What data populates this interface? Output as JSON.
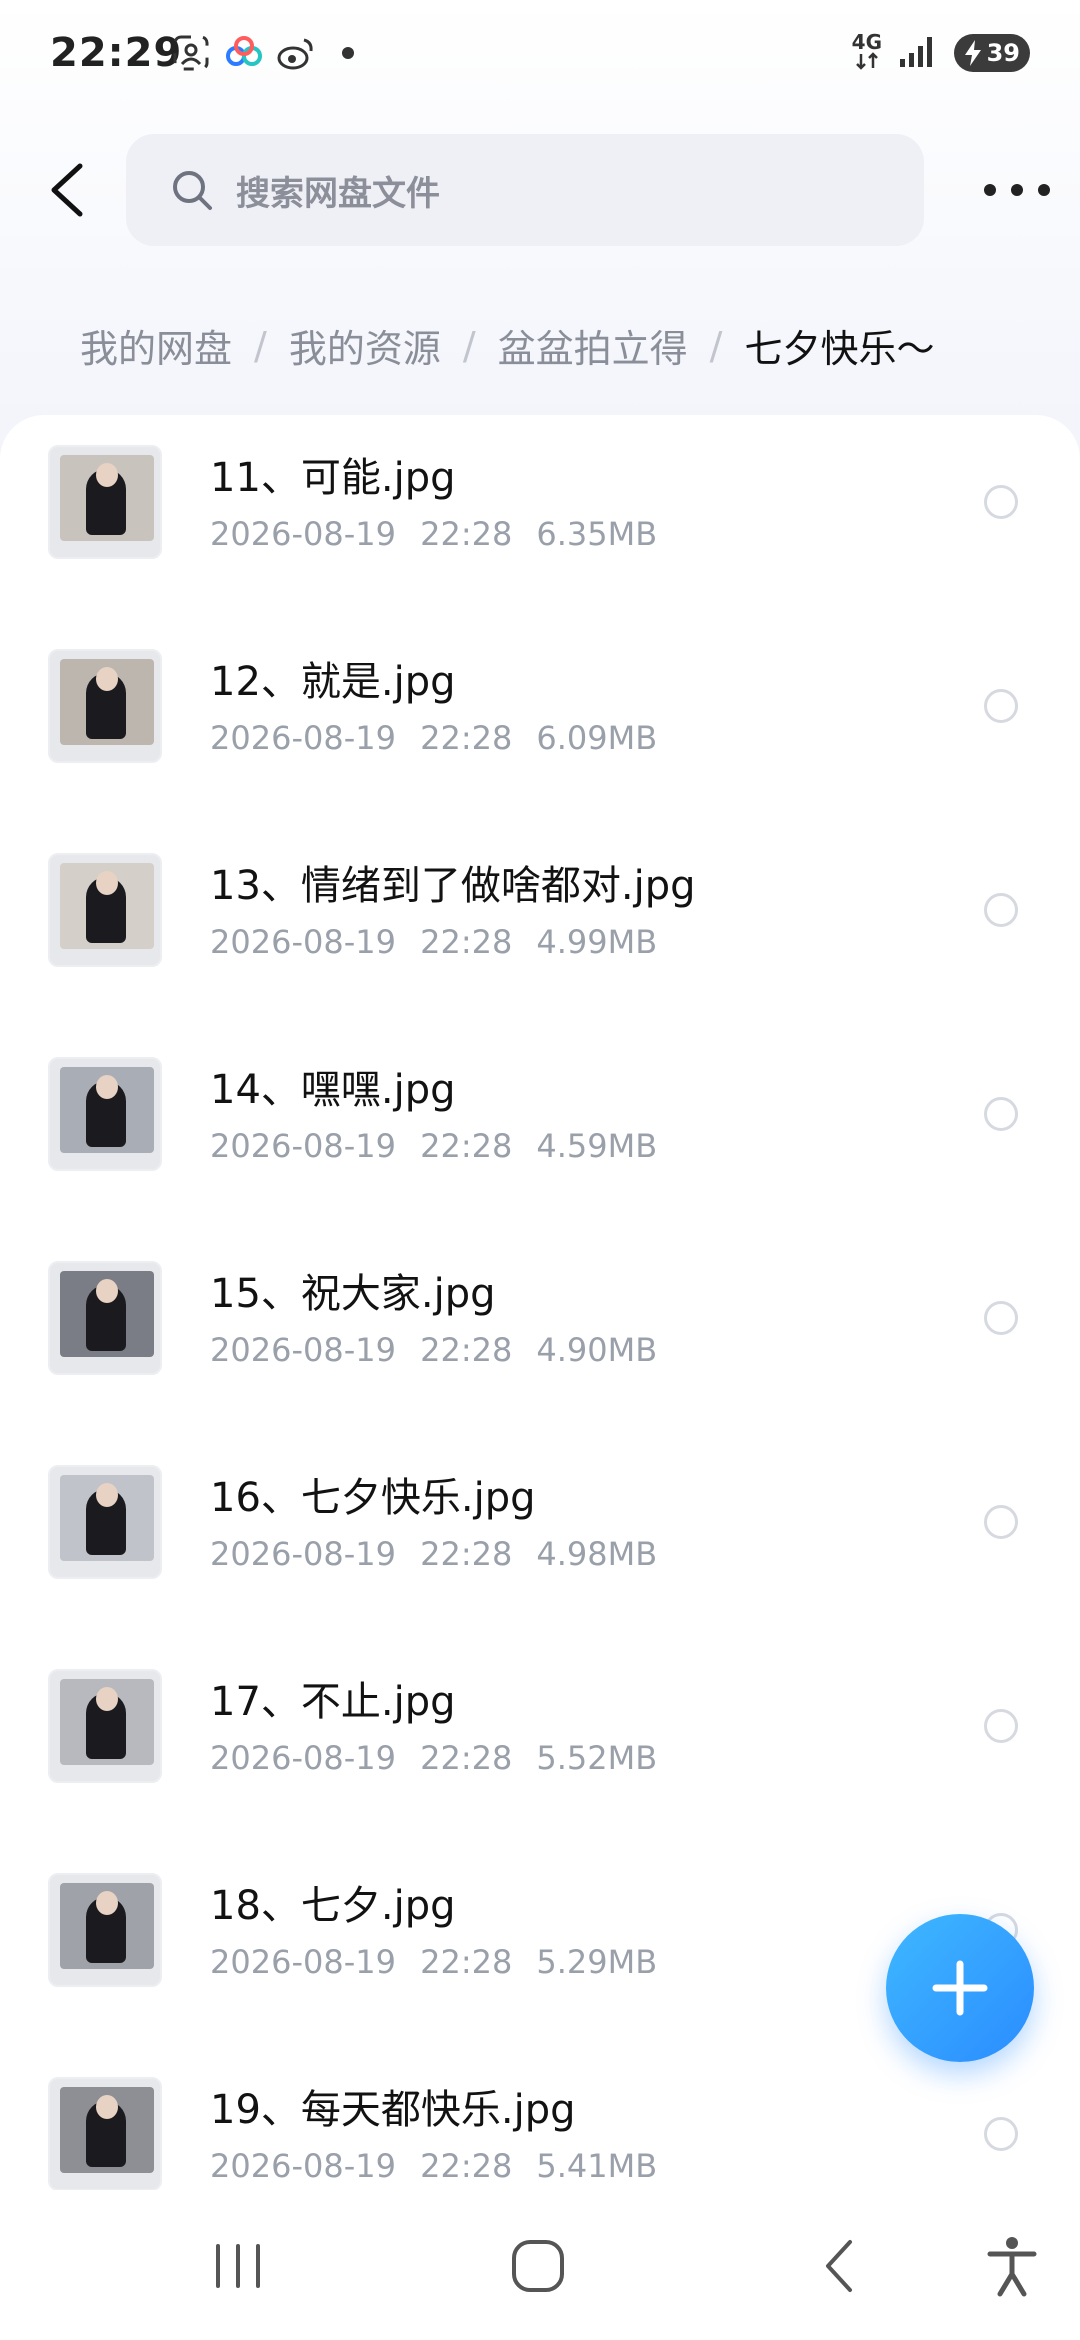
{
  "status_bar": {
    "time": "22:29",
    "network": "4G",
    "battery": "39"
  },
  "header": {
    "search_placeholder": "搜索网盘文件"
  },
  "breadcrumb": [
    "我的网盘",
    "我的资源",
    "盆盆拍立得",
    "七夕快乐～"
  ],
  "breadcrumb_separator": "/",
  "files": [
    {
      "name": "11、可能.jpg",
      "date": "2026-08-19",
      "time": "22:28",
      "size": "6.35MB"
    },
    {
      "name": "12、就是.jpg",
      "date": "2026-08-19",
      "time": "22:28",
      "size": "6.09MB"
    },
    {
      "name": "13、情绪到了做啥都对.jpg",
      "date": "2026-08-19",
      "time": "22:28",
      "size": "4.99MB"
    },
    {
      "name": "14、嘿嘿.jpg",
      "date": "2026-08-19",
      "time": "22:28",
      "size": "4.59MB"
    },
    {
      "name": "15、祝大家.jpg",
      "date": "2026-08-19",
      "time": "22:28",
      "size": "4.90MB"
    },
    {
      "name": "16、七夕快乐.jpg",
      "date": "2026-08-19",
      "time": "22:28",
      "size": "4.98MB"
    },
    {
      "name": "17、不止.jpg",
      "date": "2026-08-19",
      "time": "22:28",
      "size": "5.52MB"
    },
    {
      "name": "18、七夕.jpg",
      "date": "2026-08-19",
      "time": "22:28",
      "size": "5.29MB"
    },
    {
      "name": "19、每天都快乐.jpg",
      "date": "2026-08-19",
      "time": "22:28",
      "size": "5.41MB"
    }
  ],
  "colors": {
    "fab": "#2a8cff",
    "meta_text": "#9aa0aa",
    "breadcrumb_inactive": "#8a8e99"
  }
}
